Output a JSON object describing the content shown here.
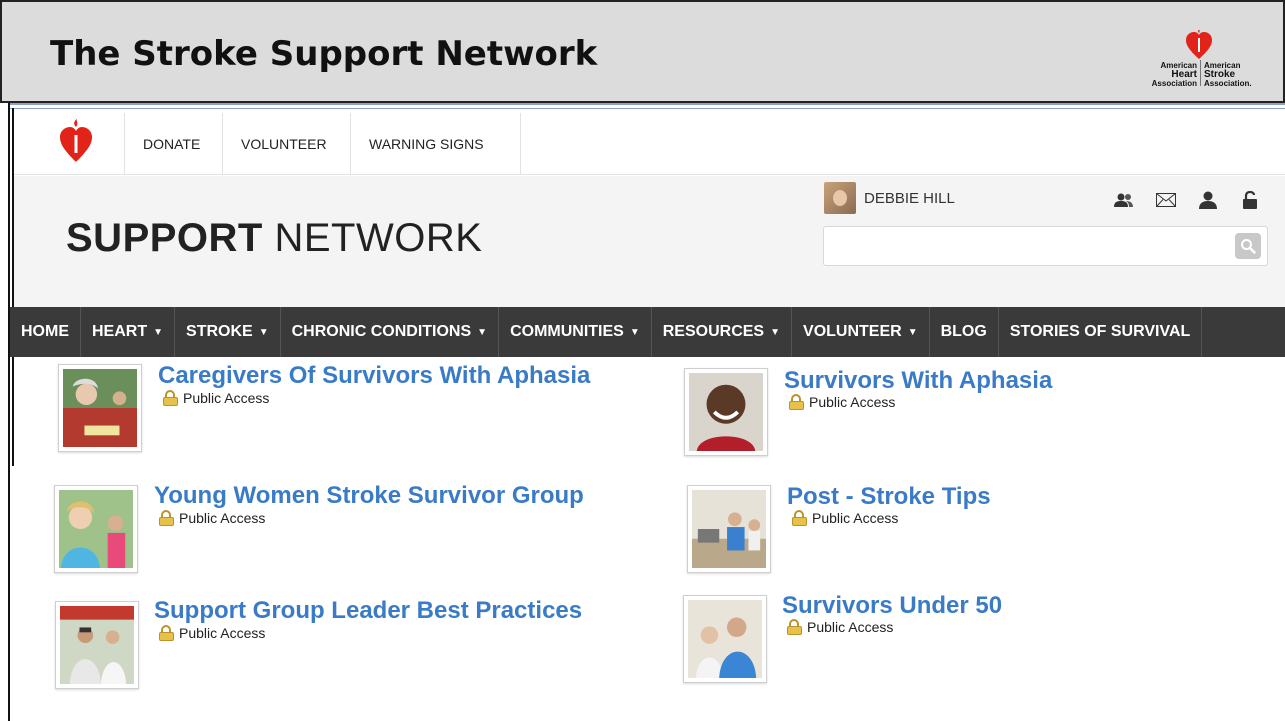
{
  "slide": {
    "title": "The Stroke Support Network",
    "logo": {
      "left_text_1": "American",
      "left_text_2": "Heart",
      "left_text_3": "Association",
      "right_text_1": "American",
      "right_text_2": "Stroke",
      "right_text_3": "Association."
    }
  },
  "utility_nav": {
    "logo_icon": "heart-torch-icon",
    "items": [
      "DONATE",
      "VOLUNTEER",
      "WARNING SIGNS"
    ]
  },
  "header": {
    "brand_bold": "SUPPORT",
    "brand_light": " NETWORK",
    "user_name": "DEBBIE HILL",
    "icons": [
      "friends-icon",
      "mail-icon",
      "profile-icon",
      "unlock-icon"
    ],
    "search_placeholder": ""
  },
  "main_nav": {
    "items": [
      {
        "label": "HOME",
        "dropdown": false
      },
      {
        "label": "HEART",
        "dropdown": true
      },
      {
        "label": "STROKE",
        "dropdown": true
      },
      {
        "label": "CHRONIC CONDITIONS",
        "dropdown": true
      },
      {
        "label": "COMMUNITIES",
        "dropdown": true
      },
      {
        "label": "RESOURCES",
        "dropdown": true
      },
      {
        "label": "VOLUNTEER",
        "dropdown": true
      },
      {
        "label": "BLOG",
        "dropdown": false
      },
      {
        "label": "STORIES OF SURVIVAL",
        "dropdown": false
      }
    ]
  },
  "groups": [
    {
      "title": "Caregivers Of Survivors With Aphasia",
      "access": "Public Access"
    },
    {
      "title": "Survivors With Aphasia",
      "access": "Public Access"
    },
    {
      "title": "Young Women Stroke Survivor Group",
      "access": "Public Access"
    },
    {
      "title": "Post - Stroke Tips",
      "access": "Public Access"
    },
    {
      "title": "Support Group Leader Best Practices",
      "access": "Public Access"
    },
    {
      "title": "Survivors Under 50",
      "access": "Public Access"
    }
  ],
  "colors": {
    "link_blue": "#3a7bc8",
    "nav_bg": "#3a3a3a",
    "aha_red": "#e2231a"
  }
}
